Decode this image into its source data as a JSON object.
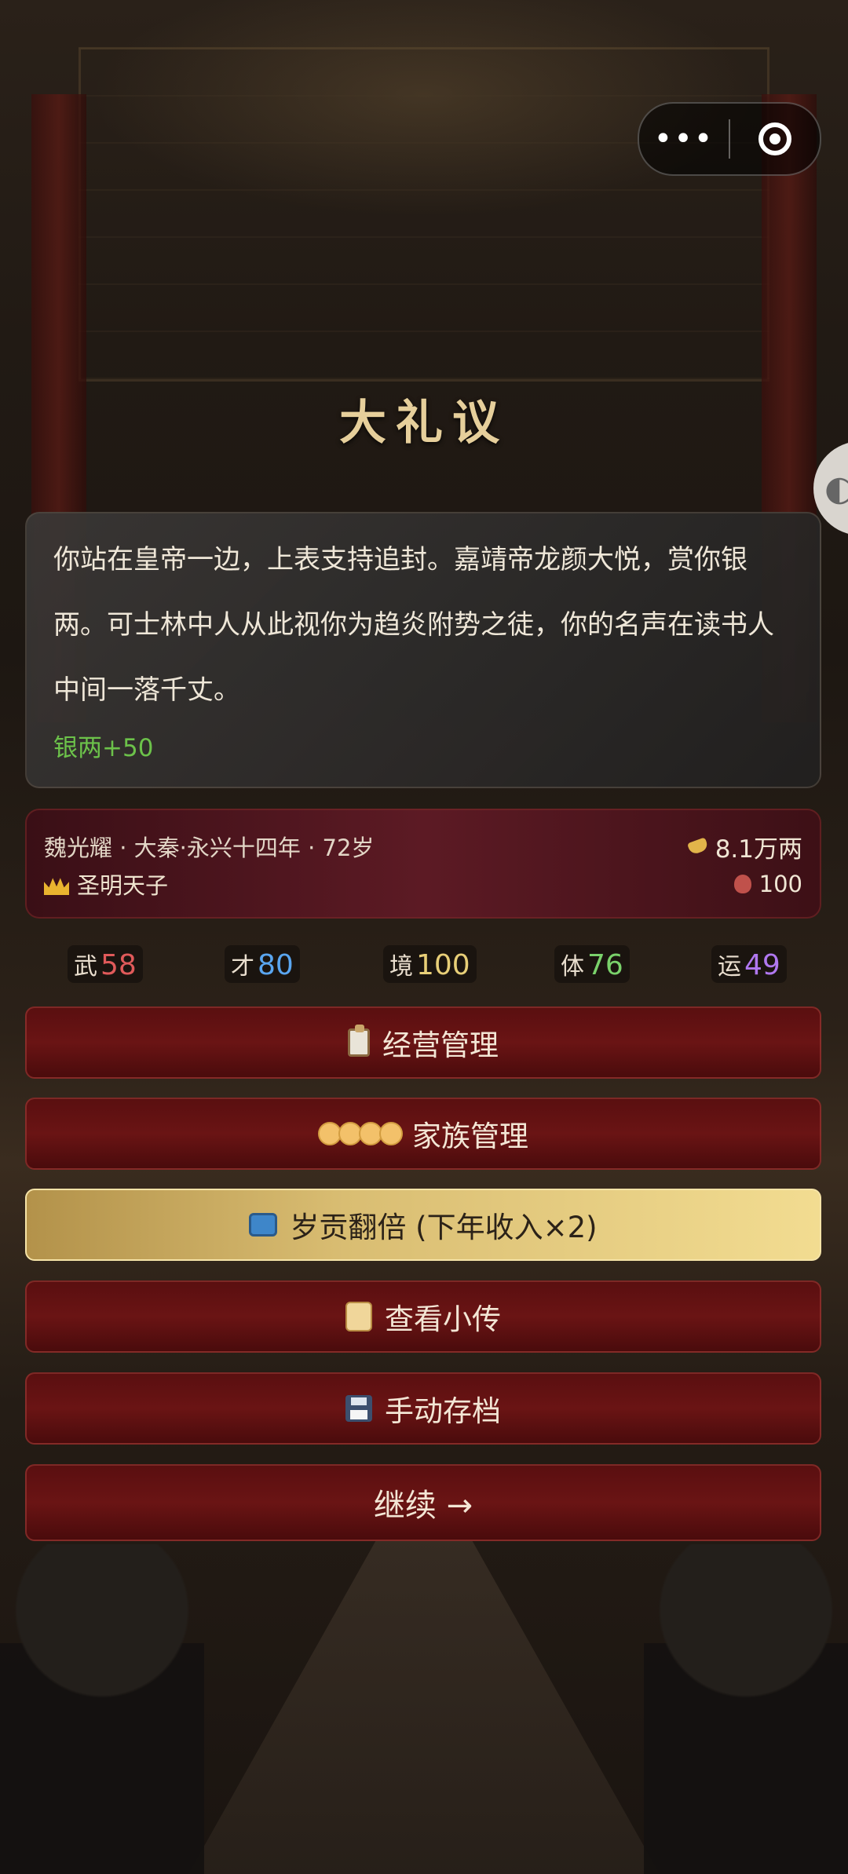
{
  "capsule": {
    "more_icon": "more-dots-icon",
    "close_icon": "target-close-icon"
  },
  "title": "大礼议",
  "story": {
    "text": "你站在皇帝一边，上表支持追封。嘉靖帝龙颜大悦，赏你银两。可士林中人从此视你为趋炎附势之徒，你的名声在读书人中间一落千丈。",
    "reward": "银两+50"
  },
  "profile": {
    "meta": "魏光耀 · 大秦·永兴十四年 · 72岁",
    "title": "圣明天子",
    "gold": "8.1万两",
    "box_value": "100"
  },
  "stats": [
    {
      "label": "武",
      "value": "58",
      "color": "#e05a5a"
    },
    {
      "label": "才",
      "value": "80",
      "color": "#5aa6f0"
    },
    {
      "label": "境",
      "value": "100",
      "color": "#e8cf78"
    },
    {
      "label": "体",
      "value": "76",
      "color": "#7ad26b"
    },
    {
      "label": "运",
      "value": "49",
      "color": "#b078f0"
    }
  ],
  "buttons": {
    "manage": "经营管理",
    "family": "家族管理",
    "tribute": "岁贡翻倍 (下年收入×2)",
    "biography": "查看小传",
    "save": "手动存档",
    "continue": "继续 →"
  }
}
